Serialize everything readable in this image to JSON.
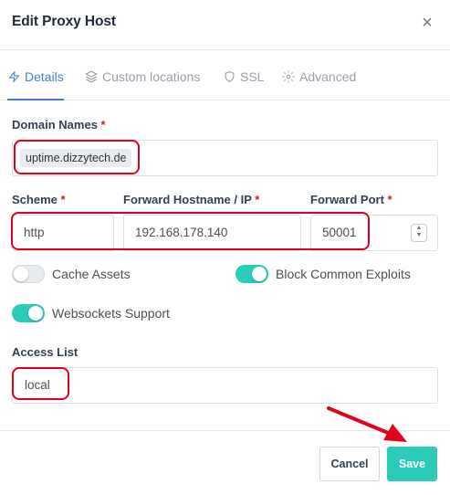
{
  "modal": {
    "title": "Edit Proxy Host",
    "close_label": "×"
  },
  "tabs": [
    {
      "label": "Details",
      "icon": "bolt-icon",
      "active": true
    },
    {
      "label": "Custom locations",
      "icon": "layers-icon",
      "active": false
    },
    {
      "label": "SSL",
      "icon": "shield-icon",
      "active": false
    },
    {
      "label": "Advanced",
      "icon": "gear-icon",
      "active": false
    }
  ],
  "domain_names": {
    "label": "Domain Names",
    "required_mark": "*",
    "chips": [
      "uptime.dizzytech.de"
    ]
  },
  "scheme": {
    "label": "Scheme",
    "required_mark": "*",
    "value": "http"
  },
  "forward_hostname": {
    "label": "Forward Hostname / IP",
    "required_mark": "*",
    "value": "192.168.178.140"
  },
  "forward_port": {
    "label": "Forward Port",
    "required_mark": "*",
    "value": "50001"
  },
  "toggles": {
    "cache_assets": {
      "label": "Cache Assets",
      "on": false
    },
    "block_exploits": {
      "label": "Block Common Exploits",
      "on": true
    },
    "websockets": {
      "label": "Websockets Support",
      "on": true
    }
  },
  "access_list": {
    "label": "Access List",
    "value": "local"
  },
  "buttons": {
    "cancel": "Cancel",
    "save": "Save"
  },
  "colors": {
    "accent": "#467fcf",
    "teal": "#2bcbba",
    "highlight_red": "#e3001b",
    "required": "#cd201f"
  }
}
